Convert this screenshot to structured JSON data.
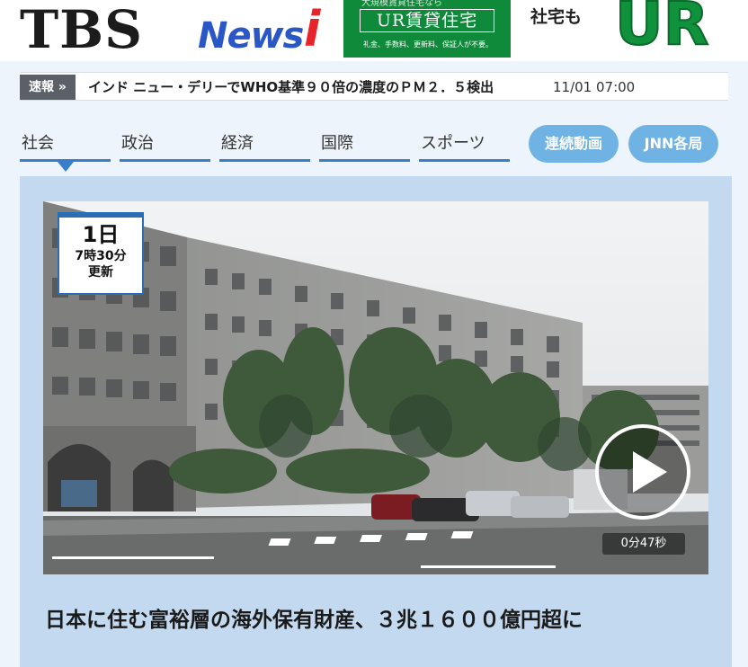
{
  "header": {
    "logo_tbs": "TBS",
    "logo_news": "News",
    "logo_i": "i",
    "ad1": {
      "top_text": "大規模賃貸住宅なら",
      "title": "UR賃貸住宅",
      "sub": "礼金、手数料、更新料、保証人が不要。"
    },
    "ad2": {
      "small": "社宅も",
      "big": "UR"
    }
  },
  "breaking": {
    "label": "速報 »",
    "text": "インド ニュー・デリーでWHO基準９０倍の濃度のＰＭ２．５検出",
    "time": "11/01 07:00"
  },
  "tabs": [
    {
      "label": "社会",
      "active": true
    },
    {
      "label": "政治"
    },
    {
      "label": "経済"
    },
    {
      "label": "国際"
    },
    {
      "label": "スポーツ"
    }
  ],
  "pills": [
    {
      "label": "連続動画"
    },
    {
      "label": "JNN各局"
    }
  ],
  "video": {
    "date_day": "1日",
    "date_time": "7時30分",
    "date_updated": "更新",
    "duration": "0分47秒"
  },
  "headline": "日本に住む富裕層の海外保有財産、３兆１６００億円超に",
  "colors": {
    "brand_blue": "#2b57c6",
    "brand_red": "#e8242a",
    "tab_underline": "#3a7ec9",
    "pill_bg": "#6fb2e4",
    "ad_green": "#0f8a3a"
  }
}
